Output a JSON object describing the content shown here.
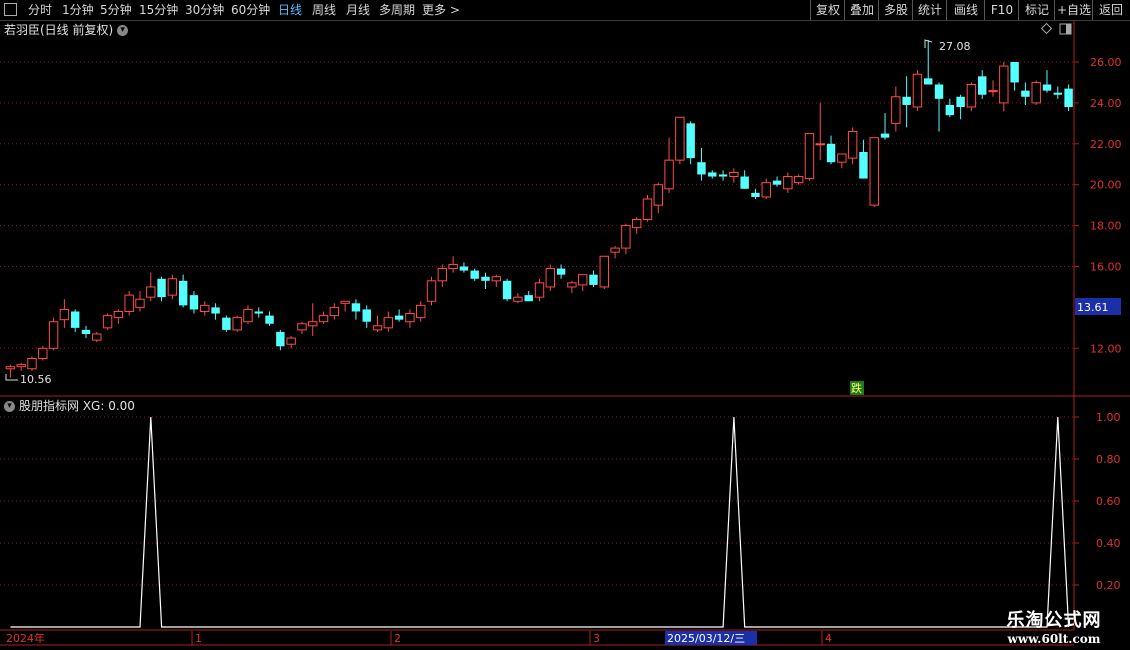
{
  "toolbar": {
    "periods": [
      "分时",
      "1分钟",
      "5分钟",
      "15分钟",
      "30分钟",
      "60分钟",
      "日线",
      "周线",
      "月线",
      "多周期",
      "更多 >"
    ],
    "active": "日线",
    "right_buttons": [
      "复权",
      "叠加",
      "多股",
      "统计",
      "画线",
      "F10",
      "标记",
      "+自选",
      "返回"
    ]
  },
  "main": {
    "title": "若羽臣(日线 前复权)",
    "price_ticks": [
      "26.00",
      "24.00",
      "22.00",
      "20.00",
      "18.00",
      "16.00",
      "12.00"
    ],
    "current_price": "13.61",
    "high_label": "27.08",
    "low_label": "10.56",
    "signal_label": "跌"
  },
  "indicator": {
    "title": "股朋指标网 XG: 0.00",
    "ticks": [
      "1.00",
      "0.80",
      "0.60",
      "0.40",
      "0.20"
    ]
  },
  "timeline": {
    "labels": [
      "2024年",
      "1",
      "2",
      "3",
      "2025/03/12/三",
      "4"
    ]
  },
  "watermark": {
    "title": "乐淘公式网",
    "url": "www.60lt.com"
  },
  "colors": {
    "up": "#ff4a4a",
    "down": "#54ffff",
    "grid": "#8b1a1a",
    "axis": "#b01e1e",
    "active_tab": "#5bb8ff"
  },
  "chart_data": {
    "type": "candlestick",
    "price_range": [
      10.0,
      27.5
    ],
    "candles": [
      [
        11.0,
        11.2,
        10.56,
        11.1
      ],
      [
        11.1,
        11.3,
        10.9,
        11.2
      ],
      [
        11.0,
        11.6,
        10.9,
        11.5
      ],
      [
        11.5,
        12.1,
        11.4,
        12.0
      ],
      [
        12.0,
        13.5,
        11.9,
        13.3
      ],
      [
        13.4,
        14.4,
        13.0,
        13.9
      ],
      [
        13.8,
        13.9,
        12.8,
        13.0
      ],
      [
        12.9,
        13.1,
        12.5,
        12.7
      ],
      [
        12.4,
        12.8,
        12.3,
        12.7
      ],
      [
        13.0,
        13.7,
        12.9,
        13.6
      ],
      [
        13.5,
        13.9,
        13.2,
        13.8
      ],
      [
        13.8,
        14.8,
        13.6,
        14.6
      ],
      [
        14.0,
        14.8,
        13.8,
        14.4
      ],
      [
        14.5,
        15.7,
        14.3,
        15.0
      ],
      [
        15.4,
        15.5,
        14.3,
        14.5
      ],
      [
        14.6,
        15.6,
        14.4,
        15.4
      ],
      [
        15.3,
        15.6,
        14.0,
        14.1
      ],
      [
        14.6,
        14.8,
        13.7,
        13.9
      ],
      [
        13.8,
        14.3,
        13.6,
        14.1
      ],
      [
        14.0,
        14.2,
        13.4,
        13.7
      ],
      [
        13.5,
        13.6,
        12.8,
        12.9
      ],
      [
        12.9,
        13.6,
        12.8,
        13.5
      ],
      [
        13.3,
        14.1,
        13.2,
        13.9
      ],
      [
        13.8,
        14.0,
        13.5,
        13.7
      ],
      [
        13.6,
        13.8,
        13.1,
        13.2
      ],
      [
        12.8,
        12.9,
        11.9,
        12.1
      ],
      [
        12.2,
        12.6,
        12.0,
        12.5
      ],
      [
        12.9,
        13.3,
        12.7,
        13.2
      ],
      [
        13.1,
        14.2,
        12.6,
        13.3
      ],
      [
        13.3,
        13.8,
        13.2,
        13.6
      ],
      [
        13.6,
        14.2,
        13.4,
        14.0
      ],
      [
        14.2,
        14.3,
        13.8,
        14.3
      ],
      [
        14.2,
        14.4,
        13.4,
        13.8
      ],
      [
        13.9,
        14.1,
        13.0,
        13.3
      ],
      [
        12.9,
        13.6,
        12.8,
        13.1
      ],
      [
        13.0,
        13.8,
        12.8,
        13.5
      ],
      [
        13.6,
        13.9,
        13.3,
        13.4
      ],
      [
        13.3,
        13.9,
        13.0,
        13.7
      ],
      [
        13.5,
        14.3,
        13.3,
        14.1
      ],
      [
        14.3,
        15.5,
        14.1,
        15.3
      ],
      [
        15.3,
        16.1,
        15.0,
        15.9
      ],
      [
        15.9,
        16.5,
        15.7,
        16.1
      ],
      [
        16.0,
        16.2,
        15.7,
        15.8
      ],
      [
        15.8,
        15.9,
        15.3,
        15.4
      ],
      [
        15.5,
        15.7,
        14.9,
        15.3
      ],
      [
        15.3,
        15.6,
        15.0,
        15.5
      ],
      [
        15.3,
        15.4,
        14.3,
        14.4
      ],
      [
        14.3,
        14.7,
        14.2,
        14.5
      ],
      [
        14.6,
        14.8,
        14.4,
        14.3
      ],
      [
        14.5,
        15.4,
        14.3,
        15.2
      ],
      [
        15.0,
        16.1,
        14.8,
        15.9
      ],
      [
        15.9,
        16.1,
        15.4,
        15.6
      ],
      [
        15.0,
        15.3,
        14.7,
        15.2
      ],
      [
        15.1,
        15.6,
        14.8,
        15.6
      ],
      [
        15.6,
        15.8,
        15.0,
        15.1
      ],
      [
        15.0,
        16.5,
        14.9,
        16.5
      ],
      [
        16.7,
        17.0,
        16.4,
        16.9
      ],
      [
        16.9,
        18.1,
        16.6,
        18.0
      ],
      [
        17.9,
        18.4,
        17.6,
        18.3
      ],
      [
        18.3,
        19.5,
        18.2,
        19.3
      ],
      [
        19.0,
        20.1,
        18.6,
        20.0
      ],
      [
        19.8,
        22.3,
        19.6,
        21.2
      ],
      [
        21.2,
        23.3,
        21.0,
        23.3
      ],
      [
        23.0,
        23.1,
        21.0,
        21.3
      ],
      [
        21.1,
        21.8,
        20.2,
        20.5
      ],
      [
        20.6,
        20.7,
        20.3,
        20.4
      ],
      [
        20.5,
        20.7,
        20.2,
        20.4
      ],
      [
        20.4,
        20.8,
        20.1,
        20.6
      ],
      [
        20.4,
        20.7,
        19.8,
        19.8
      ],
      [
        19.6,
        19.8,
        19.3,
        19.4
      ],
      [
        19.4,
        20.3,
        19.3,
        20.1
      ],
      [
        20.2,
        20.4,
        19.9,
        20.0
      ],
      [
        19.8,
        20.6,
        19.6,
        20.4
      ],
      [
        20.1,
        20.5,
        20.0,
        20.4
      ],
      [
        20.3,
        22.5,
        20.2,
        22.5
      ],
      [
        22.0,
        24.0,
        21.2,
        22.0
      ],
      [
        22.0,
        22.4,
        21.0,
        21.1
      ],
      [
        21.1,
        21.4,
        20.8,
        21.5
      ],
      [
        21.3,
        22.8,
        21.0,
        22.6
      ],
      [
        21.6,
        22.2,
        20.3,
        20.3
      ],
      [
        19.0,
        22.3,
        18.9,
        22.3
      ],
      [
        22.5,
        23.5,
        22.2,
        22.3
      ],
      [
        23.0,
        24.8,
        22.6,
        24.3
      ],
      [
        24.3,
        25.3,
        22.8,
        23.9
      ],
      [
        23.8,
        25.6,
        23.6,
        25.4
      ],
      [
        25.2,
        27.08,
        25.0,
        24.9
      ],
      [
        24.9,
        25.0,
        22.6,
        24.2
      ],
      [
        23.9,
        24.2,
        23.3,
        23.4
      ],
      [
        24.3,
        24.4,
        23.2,
        23.8
      ],
      [
        23.8,
        25.0,
        23.6,
        24.9
      ],
      [
        25.3,
        25.6,
        24.2,
        24.4
      ],
      [
        24.6,
        25.1,
        24.3,
        24.6
      ],
      [
        24.0,
        26.0,
        23.6,
        25.8
      ],
      [
        26.0,
        26.0,
        24.6,
        25.0
      ],
      [
        24.6,
        25.0,
        23.9,
        24.3
      ],
      [
        24.0,
        25.1,
        23.9,
        25.0
      ],
      [
        24.9,
        25.6,
        24.5,
        24.6
      ],
      [
        24.5,
        24.8,
        24.2,
        24.4
      ],
      [
        24.7,
        24.9,
        23.6,
        23.8
      ]
    ],
    "xg_signal_indices": [
      13,
      67,
      97
    ]
  }
}
